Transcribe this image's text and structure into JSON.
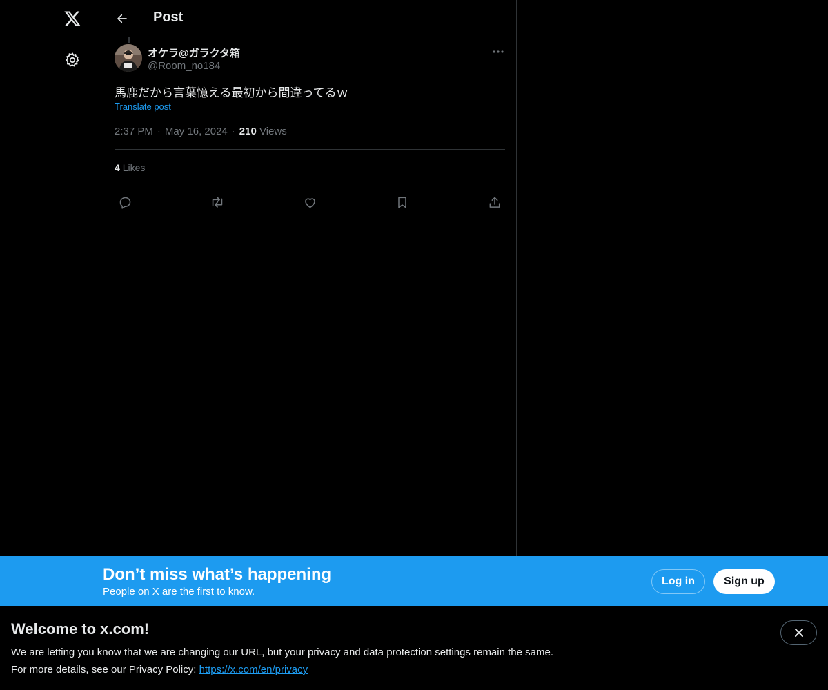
{
  "nav": {
    "logo_icon": "x-logo-icon",
    "settings_icon": "gear-icon"
  },
  "header": {
    "back_icon": "arrow-left-icon",
    "title": "Post"
  },
  "post": {
    "author_name": "オケラ@ガラクタ箱",
    "author_handle": "@Room_no184",
    "text": "馬鹿だから言葉憶える最初から間違ってるｗ",
    "translate_label": "Translate post",
    "time": "2:37 PM",
    "date": "May 16, 2024",
    "views_count": "210",
    "views_label": "Views",
    "likes_count": "4",
    "likes_label": "Likes",
    "more_icon": "more-dots-icon",
    "actions": {
      "reply_icon": "reply-icon",
      "repost_icon": "repost-icon",
      "like_icon": "heart-icon",
      "bookmark_icon": "bookmark-icon",
      "share_icon": "share-icon"
    }
  },
  "banner": {
    "title": "Don’t miss what’s happening",
    "subtitle": "People on X are the first to know.",
    "login_label": "Log in",
    "signup_label": "Sign up",
    "background_color": "#1d9bf0"
  },
  "welcome": {
    "title": "Welcome to x.com!",
    "line1": "We are letting you know that we are changing our URL, but your privacy and data protection settings remain the same.",
    "line2_prefix": "For more details, see our Privacy Policy: ",
    "privacy_link": "https://x.com/en/privacy",
    "close_icon": "close-icon"
  },
  "colors": {
    "background": "#000000",
    "text_primary": "#e7e9ea",
    "text_secondary": "#71767b",
    "accent": "#1d9bf0",
    "border": "#2f3336"
  }
}
